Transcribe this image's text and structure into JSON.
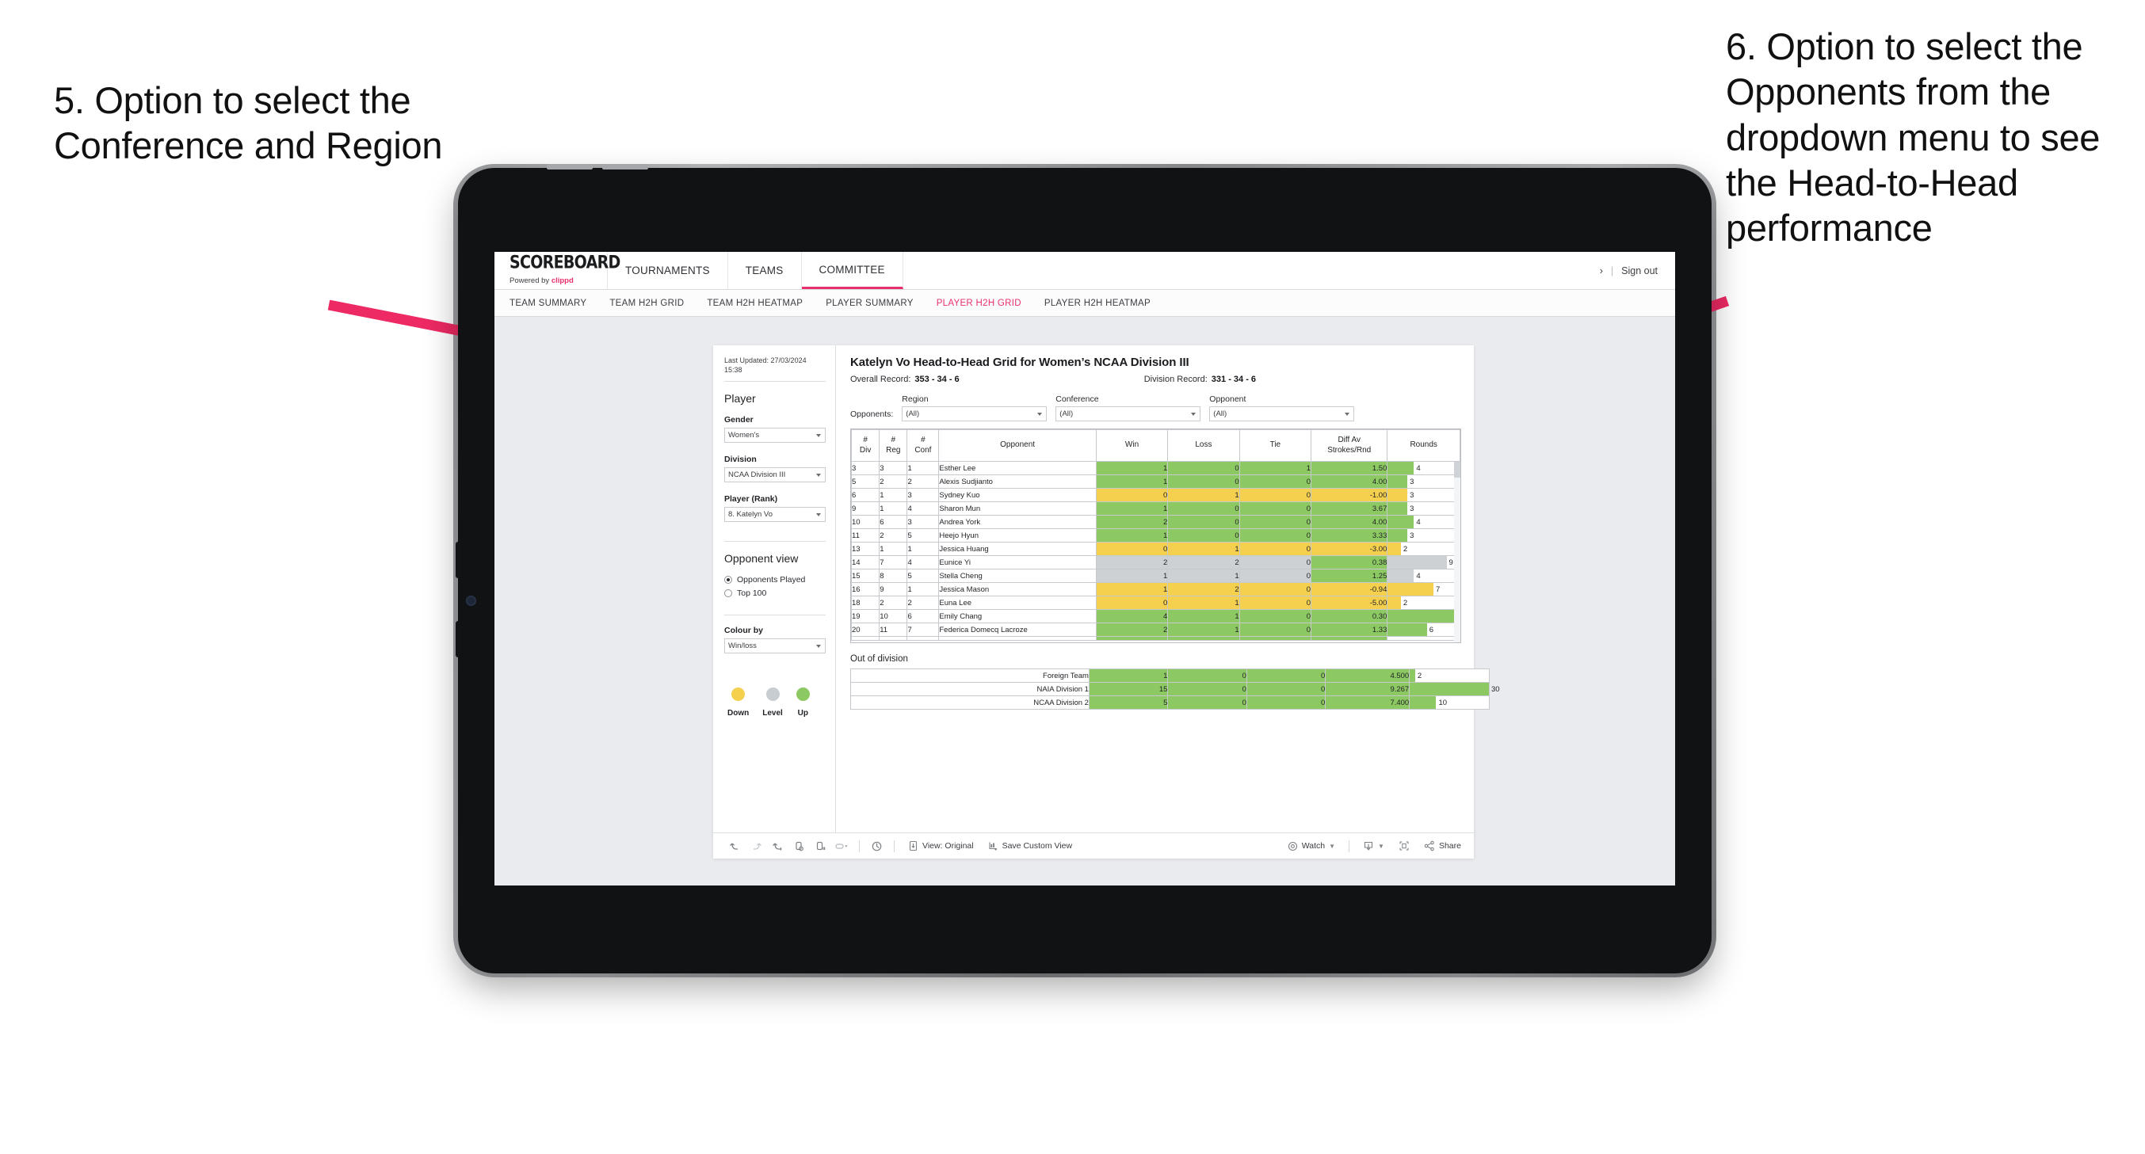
{
  "annotations": {
    "left": "5. Option to select the Conference and Region",
    "right": "6. Option to select the Opponents from the dropdown menu to see the Head-to-Head performance",
    "arrow_color": "#ed2a63"
  },
  "app": {
    "logo_word": "SCOREBOARD",
    "logo_sub_prefix": "Powered by ",
    "logo_sub_brand": "clippd",
    "top_nav": [
      {
        "label": "TOURNAMENTS",
        "active": false
      },
      {
        "label": "TEAMS",
        "active": false
      },
      {
        "label": "COMMITTEE",
        "active": true
      }
    ],
    "account": {
      "chevron": "›",
      "separator": "|",
      "sign_out": "Sign out"
    },
    "sub_nav": [
      {
        "label": "TEAM SUMMARY",
        "active": false
      },
      {
        "label": "TEAM H2H GRID",
        "active": false
      },
      {
        "label": "TEAM H2H HEATMAP",
        "active": false
      },
      {
        "label": "PLAYER SUMMARY",
        "active": false
      },
      {
        "label": "PLAYER H2H GRID",
        "active": true
      },
      {
        "label": "PLAYER H2H HEATMAP",
        "active": false
      }
    ]
  },
  "sidebar": {
    "last_updated": "Last Updated: 27/03/2024 15:38",
    "heading": "Player",
    "filters": [
      {
        "label": "Gender",
        "value": "Women's"
      },
      {
        "label": "Division",
        "value": "NCAA Division III"
      },
      {
        "label": "Player (Rank)",
        "value": "8. Katelyn Vo"
      }
    ],
    "opponent_view": {
      "heading": "Opponent view",
      "options": [
        {
          "label": "Opponents Played",
          "selected": true
        },
        {
          "label": "Top 100",
          "selected": false
        }
      ]
    },
    "colour_by": {
      "label": "Colour by",
      "value": "Win/loss"
    },
    "legend": [
      {
        "label": "Down",
        "color": "#f5d04e"
      },
      {
        "label": "Level",
        "color": "#c8cdd1"
      },
      {
        "label": "Up",
        "color": "#8dc963"
      }
    ]
  },
  "main": {
    "title": "Katelyn Vo Head-to-Head Grid for Women’s NCAA Division III",
    "overall_record_label": "Overall Record:",
    "overall_record_value": "353 -  34 - 6",
    "division_record_label": "Division Record:",
    "division_record_value": "331 -  34 - 6",
    "opponents_label": "Opponents:",
    "filters": [
      {
        "label": "Region",
        "value": "(All)"
      },
      {
        "label": "Conference",
        "value": "(All)"
      },
      {
        "label": "Opponent",
        "value": "(All)"
      }
    ]
  },
  "chart_data": {
    "type": "table",
    "title": "Katelyn Vo Head-to-Head Grid for Women’s NCAA Division III",
    "columns": [
      "# Div",
      "# Reg",
      "# Conf",
      "Opponent",
      "Win",
      "Loss",
      "Tie",
      "Diff Av Strokes/Rnd",
      "Rounds"
    ],
    "column_headers_multiline": [
      [
        "#",
        "Div"
      ],
      [
        "#",
        "Reg"
      ],
      [
        "#",
        "Conf"
      ],
      [
        "Opponent"
      ],
      [
        "Win"
      ],
      [
        "Loss"
      ],
      [
        "Tie"
      ],
      [
        "Diff Av",
        "Strokes/Rnd"
      ],
      [
        "Rounds"
      ]
    ],
    "rounds_max": 11,
    "rows": [
      {
        "div": "3",
        "reg": "3",
        "conf": "1",
        "opponent": "Esther Lee",
        "win": "1",
        "loss": "0",
        "tie": "1",
        "diff": "1.50",
        "rounds": "4",
        "state": "g"
      },
      {
        "div": "5",
        "reg": "2",
        "conf": "2",
        "opponent": "Alexis Sudjianto",
        "win": "1",
        "loss": "0",
        "tie": "0",
        "diff": "4.00",
        "rounds": "3",
        "state": "g"
      },
      {
        "div": "6",
        "reg": "1",
        "conf": "3",
        "opponent": "Sydney Kuo",
        "win": "0",
        "loss": "1",
        "tie": "0",
        "diff": "-1.00",
        "rounds": "3",
        "state": "y"
      },
      {
        "div": "9",
        "reg": "1",
        "conf": "4",
        "opponent": "Sharon Mun",
        "win": "1",
        "loss": "0",
        "tie": "0",
        "diff": "3.67",
        "rounds": "3",
        "state": "g"
      },
      {
        "div": "10",
        "reg": "6",
        "conf": "3",
        "opponent": "Andrea York",
        "win": "2",
        "loss": "0",
        "tie": "0",
        "diff": "4.00",
        "rounds": "4",
        "state": "g"
      },
      {
        "div": "11",
        "reg": "2",
        "conf": "5",
        "opponent": "Heejo Hyun",
        "win": "1",
        "loss": "0",
        "tie": "0",
        "diff": "3.33",
        "rounds": "3",
        "state": "g"
      },
      {
        "div": "13",
        "reg": "1",
        "conf": "1",
        "opponent": "Jessica Huang",
        "win": "0",
        "loss": "1",
        "tie": "0",
        "diff": "-3.00",
        "rounds": "2",
        "state": "y"
      },
      {
        "div": "14",
        "reg": "7",
        "conf": "4",
        "opponent": "Eunice Yi",
        "win": "2",
        "loss": "2",
        "tie": "0",
        "diff": "0.38",
        "rounds": "9",
        "state": "n",
        "diff_state": "g"
      },
      {
        "div": "15",
        "reg": "8",
        "conf": "5",
        "opponent": "Stella Cheng",
        "win": "1",
        "loss": "1",
        "tie": "0",
        "diff": "1.25",
        "rounds": "4",
        "state": "n",
        "diff_state": "g"
      },
      {
        "div": "16",
        "reg": "9",
        "conf": "1",
        "opponent": "Jessica Mason",
        "win": "1",
        "loss": "2",
        "tie": "0",
        "diff": "-0.94",
        "rounds": "7",
        "state": "y"
      },
      {
        "div": "18",
        "reg": "2",
        "conf": "2",
        "opponent": "Euna Lee",
        "win": "0",
        "loss": "1",
        "tie": "0",
        "diff": "-5.00",
        "rounds": "2",
        "state": "y"
      },
      {
        "div": "19",
        "reg": "10",
        "conf": "6",
        "opponent": "Emily Chang",
        "win": "4",
        "loss": "1",
        "tie": "0",
        "diff": "0.30",
        "rounds": "11",
        "state": "g"
      },
      {
        "div": "20",
        "reg": "11",
        "conf": "7",
        "opponent": "Federica Domecq Lacroze",
        "win": "2",
        "loss": "1",
        "tie": "0",
        "diff": "1.33",
        "rounds": "6",
        "state": "g"
      }
    ]
  },
  "out_of_division": {
    "title": "Out of division",
    "rounds_max": 30,
    "rows": [
      {
        "name": "Foreign Team",
        "win": "1",
        "loss": "0",
        "tie": "0",
        "diff": "4.500",
        "rounds": "2",
        "state": "g"
      },
      {
        "name": "NAIA Division 1",
        "win": "15",
        "loss": "0",
        "tie": "0",
        "diff": "9.267",
        "rounds": "30",
        "state": "g"
      },
      {
        "name": "NCAA Division 2",
        "win": "5",
        "loss": "0",
        "tie": "0",
        "diff": "7.400",
        "rounds": "10",
        "state": "g"
      }
    ]
  },
  "toolbar": {
    "view_label": "View: Original",
    "save_label": "Save Custom View",
    "watch_label": "Watch",
    "share_label": "Share"
  }
}
